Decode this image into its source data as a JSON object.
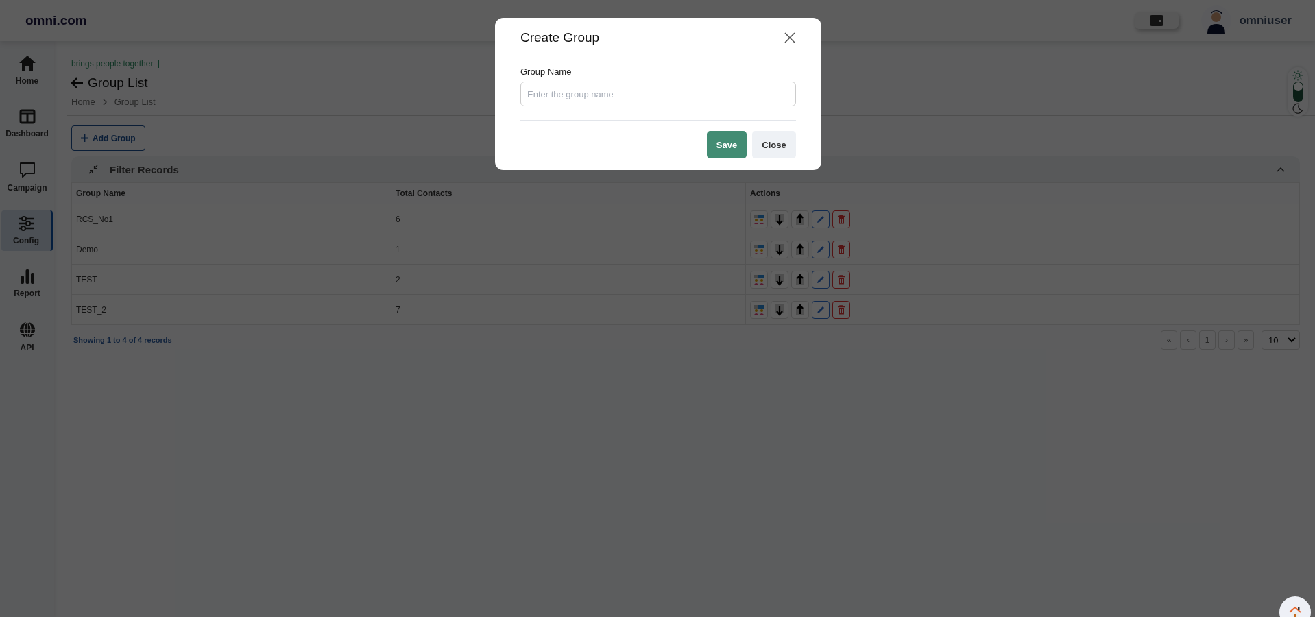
{
  "header": {
    "brand": "omni.com",
    "user_name": "omniuser"
  },
  "theme_toggle": {
    "dark_mode": false
  },
  "sidebar": {
    "items": [
      {
        "label": "Home",
        "kind": "home",
        "selected": false
      },
      {
        "label": "Dashboard",
        "kind": "dashboard",
        "selected": false
      },
      {
        "label": "Campaign",
        "kind": "campaign",
        "selected": false
      },
      {
        "label": "Config",
        "kind": "config",
        "selected": true
      },
      {
        "label": "Report",
        "kind": "report",
        "selected": false
      },
      {
        "label": "API",
        "kind": "api",
        "selected": false
      }
    ]
  },
  "page": {
    "tagline": "brings people together",
    "title": "Group List",
    "breadcrumb": [
      "Home",
      "Group List"
    ],
    "add_button": "Add Group",
    "filter_title": "Filter Records"
  },
  "table": {
    "columns": [
      "Group Name",
      "Total Contacts",
      "Actions"
    ],
    "rows": [
      {
        "group_name": "RCS_No1",
        "total_contacts": "6"
      },
      {
        "group_name": "Demo",
        "total_contacts": "1"
      },
      {
        "group_name": "TEST",
        "total_contacts": "2"
      },
      {
        "group_name": "TEST_2",
        "total_contacts": "7"
      }
    ]
  },
  "footer": {
    "showing": "Showing 1 to 4 of 4 records",
    "pagination": [
      "«",
      "‹",
      "1",
      "›",
      "»"
    ],
    "page_size": "10"
  },
  "modal": {
    "title": "Create Group",
    "field_label": "Group Name",
    "placeholder": "Enter the group name",
    "save": "Save",
    "close": "Close"
  }
}
